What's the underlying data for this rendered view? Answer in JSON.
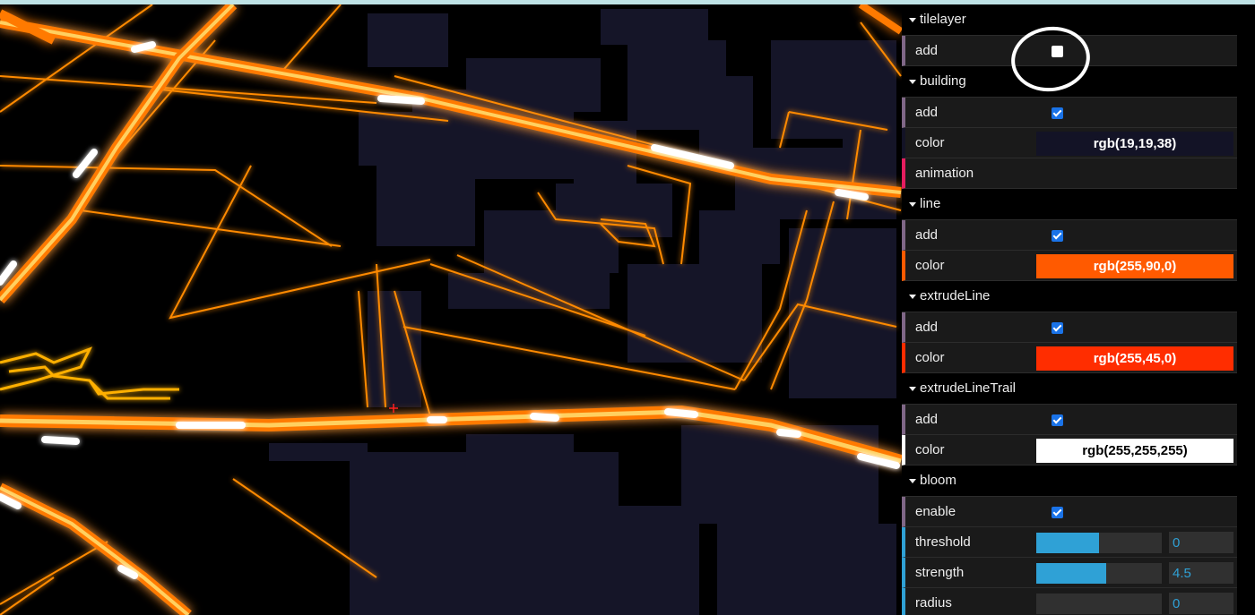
{
  "gui": {
    "folders": [
      {
        "title": "tilelayer",
        "rows": [
          {
            "type": "bool",
            "label": "add",
            "checked": false
          }
        ]
      },
      {
        "title": "building",
        "rows": [
          {
            "type": "bool",
            "label": "add",
            "checked": true
          },
          {
            "type": "color",
            "label": "color",
            "value": "rgb(19,19,38)",
            "hex": "#131326",
            "text_color": "#ffffff"
          },
          {
            "type": "function",
            "label": "animation"
          }
        ]
      },
      {
        "title": "line",
        "rows": [
          {
            "type": "bool",
            "label": "add",
            "checked": true
          },
          {
            "type": "color",
            "label": "color",
            "value": "rgb(255,90,0)",
            "hex": "#ff5a00",
            "text_color": "#ffffff"
          }
        ]
      },
      {
        "title": "extrudeLine",
        "rows": [
          {
            "type": "bool",
            "label": "add",
            "checked": true
          },
          {
            "type": "color",
            "label": "color",
            "value": "rgb(255,45,0)",
            "hex": "#ff2d00",
            "text_color": "#ffffff"
          }
        ]
      },
      {
        "title": "extrudeLineTrail",
        "rows": [
          {
            "type": "bool",
            "label": "add",
            "checked": true
          },
          {
            "type": "color",
            "label": "color",
            "value": "rgb(255,255,255)",
            "hex": "#ffffff",
            "text_color": "#000000"
          }
        ]
      },
      {
        "title": "bloom",
        "rows": [
          {
            "type": "bool",
            "label": "enable",
            "checked": true
          },
          {
            "type": "number",
            "label": "threshold",
            "value": "0",
            "fraction": 0.5
          },
          {
            "type": "number",
            "label": "strength",
            "value": "4.5",
            "fraction": 0.56
          },
          {
            "type": "number",
            "label": "radius",
            "value": "0",
            "fraction": 0.0
          }
        ]
      }
    ]
  }
}
